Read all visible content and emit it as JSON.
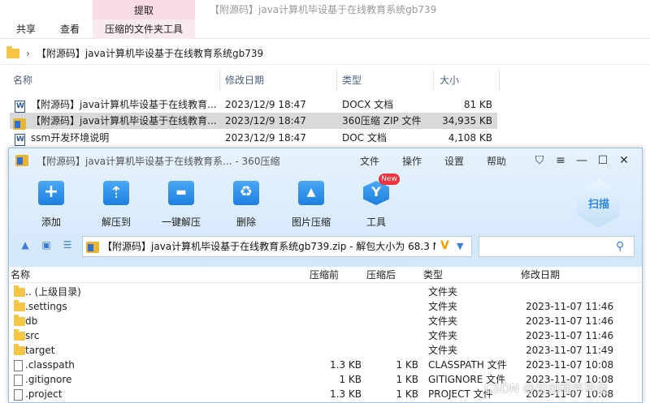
{
  "explorer": {
    "window_title": "【附源码】java计算机毕设基于在线教育系统gb739",
    "contextual_tab": "提取",
    "ribbon_tabs": [
      "共享",
      "查看",
      "压缩的文件夹工具"
    ],
    "address": "【附源码】java计算机毕设基于在线教育系统gb739",
    "columns": [
      "名称",
      "修改日期",
      "类型",
      "大小"
    ],
    "files": [
      {
        "name": "【附源码】java计算机毕设基于在线教育...",
        "date": "2023/12/9 18:47",
        "type": "DOCX 文档",
        "size": "81 KB",
        "icon": "word-doc-icon"
      },
      {
        "name": "【附源码】java计算机毕设基于在线教育...",
        "date": "2023/12/9 18:47",
        "type": "360压缩 ZIP 文件",
        "size": "34,935 KB",
        "icon": "zip-archive-icon",
        "selected": true
      },
      {
        "name": "ssm开发环境说明",
        "date": "2023/12/9 18:47",
        "type": "DOC 文档",
        "size": "4,108 KB",
        "icon": "word-doc-icon"
      }
    ]
  },
  "zip_window": {
    "title": "【附源码】java计算机毕设基于在线教育系... - 360压缩",
    "menu": [
      "文件",
      "操作",
      "设置",
      "帮助"
    ],
    "toolbar": [
      {
        "label": "添加",
        "icon": "add-icon"
      },
      {
        "label": "解压到",
        "icon": "extract-to-icon"
      },
      {
        "label": "一键解压",
        "icon": "one-click-extract-icon"
      },
      {
        "label": "删除",
        "icon": "delete-icon"
      },
      {
        "label": "图片压缩",
        "icon": "image-compress-icon"
      },
      {
        "label": "工具",
        "icon": "tools-icon"
      }
    ],
    "new_badge": "New",
    "scan_label": "扫描",
    "path": "【附源码】java计算机毕设基于在线教育系统gb739.zip - 解包大小为 68.3 M",
    "columns": [
      "名称",
      "压缩前",
      "压缩后",
      "类型",
      "修改日期"
    ],
    "rows": [
      {
        "name": ".. (上级目录)",
        "before": "",
        "after": "",
        "type": "文件夹",
        "date": "",
        "kind": "folder"
      },
      {
        "name": ".settings",
        "before": "",
        "after": "",
        "type": "文件夹",
        "date": "2023-11-07 11:46",
        "kind": "folder"
      },
      {
        "name": "db",
        "before": "",
        "after": "",
        "type": "文件夹",
        "date": "2023-11-07 11:46",
        "kind": "folder"
      },
      {
        "name": "src",
        "before": "",
        "after": "",
        "type": "文件夹",
        "date": "2023-11-07 11:46",
        "kind": "folder"
      },
      {
        "name": "target",
        "before": "",
        "after": "",
        "type": "文件夹",
        "date": "2023-11-07 11:49",
        "kind": "folder"
      },
      {
        "name": ".classpath",
        "before": "1.3 KB",
        "after": "1 KB",
        "type": "CLASSPATH 文件",
        "date": "2023-11-07 10:08",
        "kind": "file"
      },
      {
        "name": ".gitignore",
        "before": "1 KB",
        "after": "1 KB",
        "type": "GITIGNORE 文件",
        "date": "2023-11-07 10:08",
        "kind": "file"
      },
      {
        "name": ".project",
        "before": "1.3 KB",
        "after": "1 KB",
        "type": "PROJECT 文件",
        "date": "2023-11-07 10:08",
        "kind": "file"
      }
    ]
  },
  "watermark": "CSDN @初创程序毕设",
  "colors": {
    "accent": "#2f86e4",
    "extract_tab": "#f9dbe6",
    "selected_row": "#d9d9d9"
  }
}
